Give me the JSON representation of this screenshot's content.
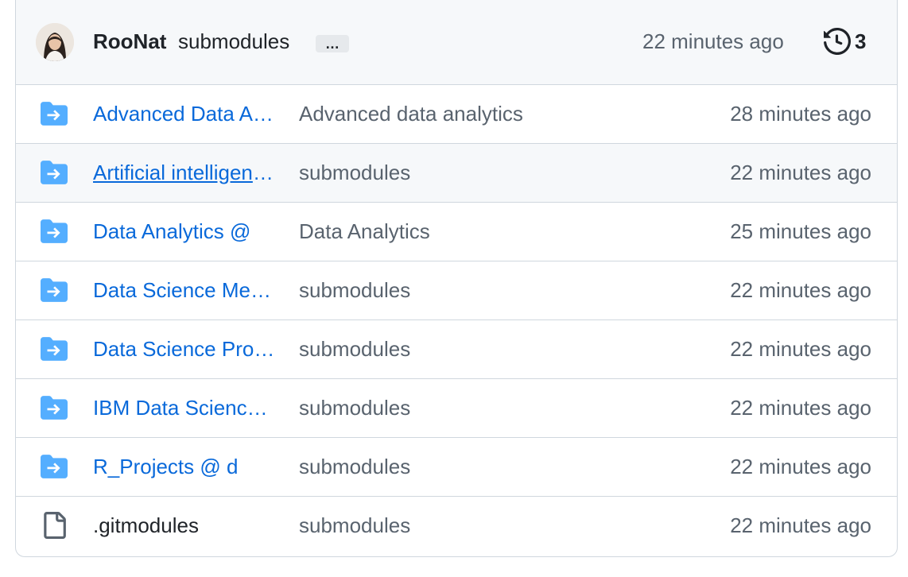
{
  "header": {
    "author": "RooNat",
    "commit_message": "submodules",
    "ellipsis_label": "…",
    "time": "22 minutes ago",
    "history_count": "3",
    "history_icon": "history-icon"
  },
  "colors": {
    "link": "#0969da",
    "muted": "#59636e",
    "folder": "#54aeff",
    "border": "#d0d7de",
    "header_bg": "#f6f8fa"
  },
  "files": [
    {
      "name": "Advanced Data Analytics @ ",
      "message": "Advanced data analytics",
      "time": "28 minutes ago",
      "icon": "submodule-folder-icon"
    },
    {
      "name": "Artificial intelligence @ ",
      "message": "submodules",
      "time": "22 minutes ago",
      "icon": "submodule-folder-icon"
    },
    {
      "name": "Data Analytics @ ",
      "message": "Data Analytics",
      "time": "25 minutes ago",
      "icon": "submodule-folder-icon"
    },
    {
      "name": "Data Science Methods @ ",
      "message": "submodules",
      "time": "22 minutes ago",
      "icon": "submodule-folder-icon"
    },
    {
      "name": "Data Science Projects @ ",
      "message": "submodules",
      "time": "22 minutes ago",
      "icon": "submodule-folder-icon"
    },
    {
      "name": "IBM Data Science @ ",
      "message": "submodules",
      "time": "22 minutes ago",
      "icon": "submodule-folder-icon"
    },
    {
      "name": "R_Projects @ d",
      "message": "submodules",
      "time": "22 minutes ago",
      "icon": "submodule-folder-icon"
    },
    {
      "name": ".gitmodules",
      "message": "submodules",
      "time": "22 minutes ago",
      "icon": "file-icon"
    }
  ]
}
